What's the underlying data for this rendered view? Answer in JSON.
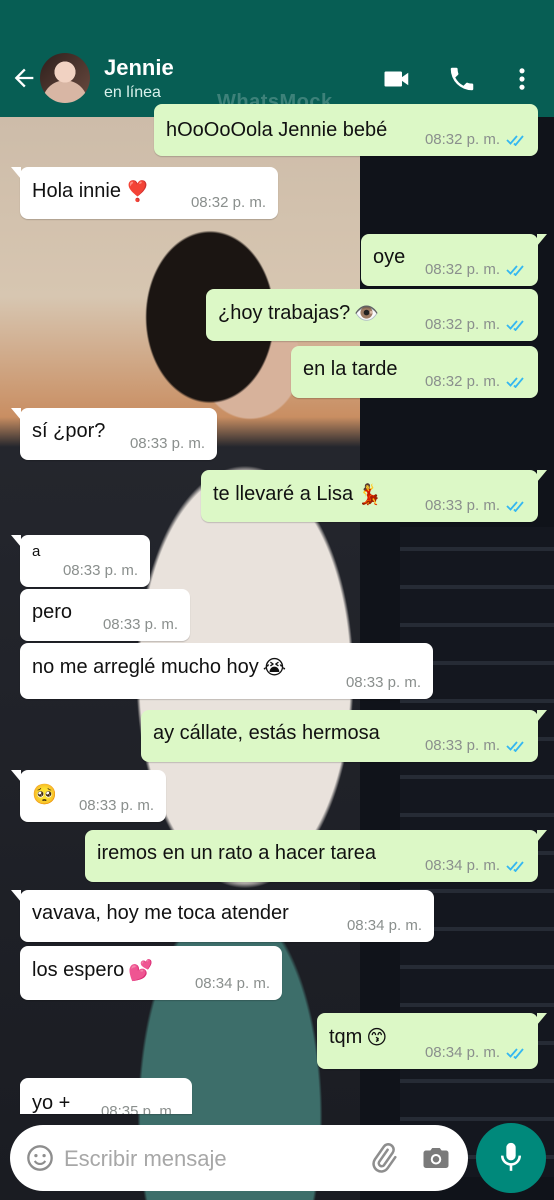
{
  "header": {
    "contact_name": "Jennie",
    "contact_status": "en línea",
    "watermark": "WhatsMock"
  },
  "colors": {
    "header_bg": "#075e54",
    "outgoing_bubble": "#dcf8c6",
    "incoming_bubble": "#ffffff",
    "read_ticks": "#34b7f1",
    "mic_button": "#00897b"
  },
  "messages": [
    {
      "direction": "out",
      "text": "hOoOoOola Jennie bebé",
      "time": "08:32 p. m.",
      "status": "read"
    },
    {
      "direction": "in",
      "text": "Hola innie",
      "emoji": "❣️",
      "time": "08:32 p. m."
    },
    {
      "direction": "out",
      "text": "oye",
      "time": "08:32 p. m.",
      "status": "read"
    },
    {
      "direction": "out",
      "text": "¿hoy trabajas?",
      "emoji": "👁️",
      "time": "08:32 p. m.",
      "status": "read"
    },
    {
      "direction": "out",
      "text": "en la tarde",
      "time": "08:32 p. m.",
      "status": "read"
    },
    {
      "direction": "in",
      "text": "sí ¿por?",
      "time": "08:33 p. m."
    },
    {
      "direction": "out",
      "text": "te llevaré a Lisa",
      "emoji": "💃",
      "time": "08:33 p. m.",
      "status": "read"
    },
    {
      "direction": "in",
      "text": "a",
      "time": "08:33 p. m."
    },
    {
      "direction": "in",
      "text": "pero",
      "time": "08:33 p. m."
    },
    {
      "direction": "in",
      "text": "no me arreglé mucho hoy",
      "emoji": "😭",
      "time": "08:33 p. m."
    },
    {
      "direction": "out",
      "text": "ay cállate, estás hermosa",
      "time": "08:33 p. m.",
      "status": "read"
    },
    {
      "direction": "in",
      "text": "",
      "emoji": "🥺",
      "time": "08:33 p. m."
    },
    {
      "direction": "out",
      "text": "iremos en un rato a hacer tarea",
      "time": "08:34 p. m.",
      "status": "read"
    },
    {
      "direction": "in",
      "text": "vavava, hoy me toca atender",
      "time": "08:34 p. m."
    },
    {
      "direction": "in",
      "text": "los espero",
      "emoji": "💕",
      "time": "08:34 p. m."
    },
    {
      "direction": "out",
      "text": "tqm",
      "emoji": "😙",
      "time": "08:34 p. m.",
      "status": "read"
    },
    {
      "direction": "in",
      "text": "yo +",
      "time": "08:35 p. m."
    }
  ],
  "composer": {
    "placeholder": "Escribir mensaje"
  },
  "icons": {
    "back": "arrow-left-icon",
    "video": "video-camera-icon",
    "call": "phone-icon",
    "menu": "more-vertical-icon",
    "emoji": "smile-icon",
    "attach": "paperclip-icon",
    "camera": "camera-icon",
    "voice": "microphone-icon"
  }
}
